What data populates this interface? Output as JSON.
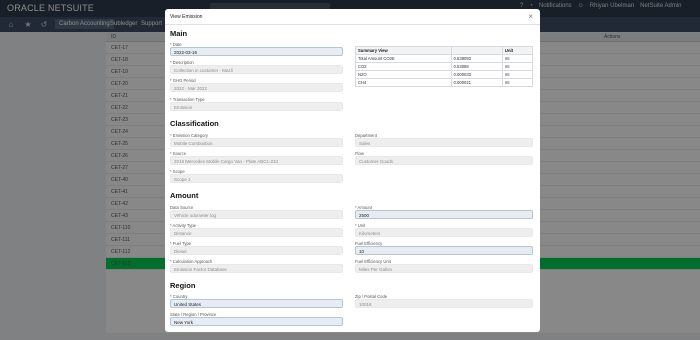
{
  "header": {
    "logo_main": "ORACLE NETSUITE",
    "notifications_label": "Notifications",
    "user_name": "Rhiyan Ubelman",
    "user_role": "NetSuite Admin"
  },
  "nav": {
    "items": [
      "Carbon Accounting",
      "Subledger",
      "Support"
    ]
  },
  "list": {
    "column": "ID",
    "actions_header": "Actions",
    "rows": [
      "CET-17",
      "CET-18",
      "CET-19",
      "CET-20",
      "CET-21",
      "CET-22",
      "CET-23",
      "CET-24",
      "CET-25",
      "CET-26",
      "CET-27",
      "CET-40",
      "CET-41",
      "CET-42",
      "CET-43",
      "CET-110",
      "CET-111",
      "CET-112",
      "CET-113"
    ]
  },
  "modal": {
    "title": "View Emission",
    "close_icon": "close-icon",
    "sections": {
      "main": "Main",
      "classification": "Classification",
      "amount": "Amount",
      "region": "Region"
    },
    "fields": {
      "date": {
        "label": "* Date",
        "value": "2022-03-16"
      },
      "description": {
        "label": "* Description",
        "value": "Collection in customer - Mazli"
      },
      "ghg_period": {
        "label": "* GHG Period",
        "value": "2022 - Mar 2022"
      },
      "transaction_type": {
        "label": "* Transaction Type",
        "value": "Emission"
      },
      "emission_category": {
        "label": "* Emission Category",
        "value": "Mobile Combustion"
      },
      "department": {
        "label": "Department",
        "value": "Sales"
      },
      "source": {
        "label": "* Source",
        "value": "2019 Mercedes Mobile Cargo Van - Plate ABC1-234"
      },
      "flow": {
        "label": "Flow",
        "value": "Customer Goods"
      },
      "scope": {
        "label": "* Scope",
        "value": "Scope 1"
      },
      "data_source": {
        "label": "Data Source",
        "value": "Vehicle odometer log"
      },
      "amount": {
        "label": "* Amount",
        "value": "2500"
      },
      "activity_type": {
        "label": "* Activity Type",
        "value": "Distance"
      },
      "unit": {
        "label": "* Unit",
        "value": "Kilometers"
      },
      "fuel_type": {
        "label": "* Fuel Type",
        "value": "Diesel"
      },
      "fuel_efficiency": {
        "label": "Fuel Efficiency",
        "value": "10"
      },
      "calculation_approach": {
        "label": "* Calculation Approach",
        "value": "Emission Factor Database"
      },
      "fuel_efficiency_unit": {
        "label": "Fuel Efficiency Unit",
        "value": "Miles Per Gallon"
      },
      "country": {
        "label": "* Country",
        "value": "United States"
      },
      "zip": {
        "label": "Zip / Postal Code",
        "value": "10016"
      },
      "state": {
        "label": "State / Region / Province",
        "value": "New York"
      }
    },
    "summary": {
      "headers": [
        "Summary View",
        "",
        "Unit"
      ],
      "rows": [
        {
          "name": "Total Amount CO2E",
          "value": "0.539093",
          "unit": "mt"
        },
        {
          "name": "CO2",
          "value": "0.53088",
          "unit": "mt"
        },
        {
          "name": "N2O",
          "value": "0.000033",
          "unit": "mt"
        },
        {
          "name": "CH4",
          "value": "0.000021",
          "unit": "mt"
        }
      ]
    }
  },
  "colors": {
    "topbar": "#2f3a4a",
    "navbar": "#3c4c63",
    "selected_row": "#00c853"
  }
}
